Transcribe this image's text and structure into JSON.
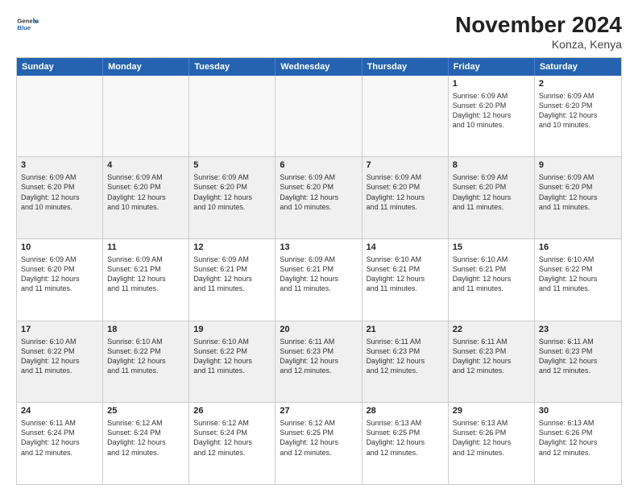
{
  "logo": {
    "general": "General",
    "blue": "Blue"
  },
  "header": {
    "title": "November 2024",
    "location": "Konza, Kenya"
  },
  "days": [
    "Sunday",
    "Monday",
    "Tuesday",
    "Wednesday",
    "Thursday",
    "Friday",
    "Saturday"
  ],
  "weeks": [
    [
      {
        "day": "",
        "empty": true
      },
      {
        "day": "",
        "empty": true
      },
      {
        "day": "",
        "empty": true
      },
      {
        "day": "",
        "empty": true
      },
      {
        "day": "",
        "empty": true
      },
      {
        "day": "1",
        "lines": [
          "Sunrise: 6:09 AM",
          "Sunset: 6:20 PM",
          "Daylight: 12 hours",
          "and 10 minutes."
        ]
      },
      {
        "day": "2",
        "lines": [
          "Sunrise: 6:09 AM",
          "Sunset: 6:20 PM",
          "Daylight: 12 hours",
          "and 10 minutes."
        ]
      }
    ],
    [
      {
        "day": "3",
        "lines": [
          "Sunrise: 6:09 AM",
          "Sunset: 6:20 PM",
          "Daylight: 12 hours",
          "and 10 minutes."
        ]
      },
      {
        "day": "4",
        "lines": [
          "Sunrise: 6:09 AM",
          "Sunset: 6:20 PM",
          "Daylight: 12 hours",
          "and 10 minutes."
        ]
      },
      {
        "day": "5",
        "lines": [
          "Sunrise: 6:09 AM",
          "Sunset: 6:20 PM",
          "Daylight: 12 hours",
          "and 10 minutes."
        ]
      },
      {
        "day": "6",
        "lines": [
          "Sunrise: 6:09 AM",
          "Sunset: 6:20 PM",
          "Daylight: 12 hours",
          "and 10 minutes."
        ]
      },
      {
        "day": "7",
        "lines": [
          "Sunrise: 6:09 AM",
          "Sunset: 6:20 PM",
          "Daylight: 12 hours",
          "and 11 minutes."
        ]
      },
      {
        "day": "8",
        "lines": [
          "Sunrise: 6:09 AM",
          "Sunset: 6:20 PM",
          "Daylight: 12 hours",
          "and 11 minutes."
        ]
      },
      {
        "day": "9",
        "lines": [
          "Sunrise: 6:09 AM",
          "Sunset: 6:20 PM",
          "Daylight: 12 hours",
          "and 11 minutes."
        ]
      }
    ],
    [
      {
        "day": "10",
        "lines": [
          "Sunrise: 6:09 AM",
          "Sunset: 6:20 PM",
          "Daylight: 12 hours",
          "and 11 minutes."
        ]
      },
      {
        "day": "11",
        "lines": [
          "Sunrise: 6:09 AM",
          "Sunset: 6:21 PM",
          "Daylight: 12 hours",
          "and 11 minutes."
        ]
      },
      {
        "day": "12",
        "lines": [
          "Sunrise: 6:09 AM",
          "Sunset: 6:21 PM",
          "Daylight: 12 hours",
          "and 11 minutes."
        ]
      },
      {
        "day": "13",
        "lines": [
          "Sunrise: 6:09 AM",
          "Sunset: 6:21 PM",
          "Daylight: 12 hours",
          "and 11 minutes."
        ]
      },
      {
        "day": "14",
        "lines": [
          "Sunrise: 6:10 AM",
          "Sunset: 6:21 PM",
          "Daylight: 12 hours",
          "and 11 minutes."
        ]
      },
      {
        "day": "15",
        "lines": [
          "Sunrise: 6:10 AM",
          "Sunset: 6:21 PM",
          "Daylight: 12 hours",
          "and 11 minutes."
        ]
      },
      {
        "day": "16",
        "lines": [
          "Sunrise: 6:10 AM",
          "Sunset: 6:22 PM",
          "Daylight: 12 hours",
          "and 11 minutes."
        ]
      }
    ],
    [
      {
        "day": "17",
        "lines": [
          "Sunrise: 6:10 AM",
          "Sunset: 6:22 PM",
          "Daylight: 12 hours",
          "and 11 minutes."
        ]
      },
      {
        "day": "18",
        "lines": [
          "Sunrise: 6:10 AM",
          "Sunset: 6:22 PM",
          "Daylight: 12 hours",
          "and 11 minutes."
        ]
      },
      {
        "day": "19",
        "lines": [
          "Sunrise: 6:10 AM",
          "Sunset: 6:22 PM",
          "Daylight: 12 hours",
          "and 11 minutes."
        ]
      },
      {
        "day": "20",
        "lines": [
          "Sunrise: 6:11 AM",
          "Sunset: 6:23 PM",
          "Daylight: 12 hours",
          "and 12 minutes."
        ]
      },
      {
        "day": "21",
        "lines": [
          "Sunrise: 6:11 AM",
          "Sunset: 6:23 PM",
          "Daylight: 12 hours",
          "and 12 minutes."
        ]
      },
      {
        "day": "22",
        "lines": [
          "Sunrise: 6:11 AM",
          "Sunset: 6:23 PM",
          "Daylight: 12 hours",
          "and 12 minutes."
        ]
      },
      {
        "day": "23",
        "lines": [
          "Sunrise: 6:11 AM",
          "Sunset: 6:23 PM",
          "Daylight: 12 hours",
          "and 12 minutes."
        ]
      }
    ],
    [
      {
        "day": "24",
        "lines": [
          "Sunrise: 6:11 AM",
          "Sunset: 6:24 PM",
          "Daylight: 12 hours",
          "and 12 minutes."
        ]
      },
      {
        "day": "25",
        "lines": [
          "Sunrise: 6:12 AM",
          "Sunset: 6:24 PM",
          "Daylight: 12 hours",
          "and 12 minutes."
        ]
      },
      {
        "day": "26",
        "lines": [
          "Sunrise: 6:12 AM",
          "Sunset: 6:24 PM",
          "Daylight: 12 hours",
          "and 12 minutes."
        ]
      },
      {
        "day": "27",
        "lines": [
          "Sunrise: 6:12 AM",
          "Sunset: 6:25 PM",
          "Daylight: 12 hours",
          "and 12 minutes."
        ]
      },
      {
        "day": "28",
        "lines": [
          "Sunrise: 6:13 AM",
          "Sunset: 6:25 PM",
          "Daylight: 12 hours",
          "and 12 minutes."
        ]
      },
      {
        "day": "29",
        "lines": [
          "Sunrise: 6:13 AM",
          "Sunset: 6:26 PM",
          "Daylight: 12 hours",
          "and 12 minutes."
        ]
      },
      {
        "day": "30",
        "lines": [
          "Sunrise: 6:13 AM",
          "Sunset: 6:26 PM",
          "Daylight: 12 hours",
          "and 12 minutes."
        ]
      }
    ]
  ]
}
